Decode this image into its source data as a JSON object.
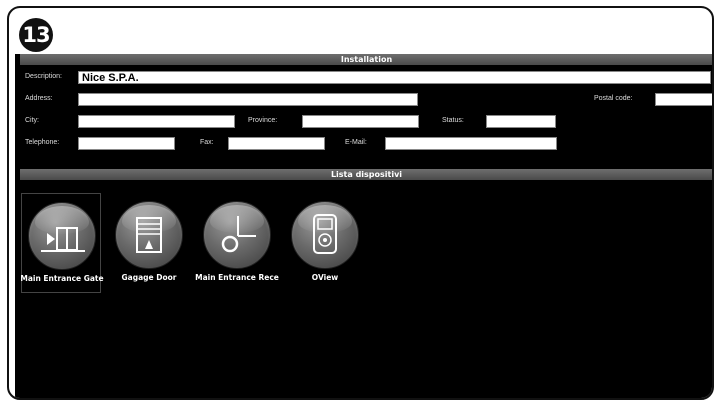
{
  "step": {
    "number": "13"
  },
  "installation": {
    "title": "Installation",
    "description": {
      "label": "Description:",
      "value": "Nice S.P.A."
    },
    "address": {
      "label": "Address:",
      "value": ""
    },
    "postal_code": {
      "label": "Postal code:",
      "value": ""
    },
    "city": {
      "label": "City:",
      "value": ""
    },
    "province": {
      "label": "Province:",
      "value": ""
    },
    "status": {
      "label": "Status:",
      "value": ""
    },
    "telephone": {
      "label": "Telephone:",
      "value": ""
    },
    "fax": {
      "label": "Fax:",
      "value": ""
    },
    "email": {
      "label": "E-Mail:",
      "value": ""
    }
  },
  "devices": {
    "title": "Lista dispositivi",
    "items": [
      {
        "label": "Main Entrance Gate",
        "icon": "gate-icon"
      },
      {
        "label": "Gagage Door",
        "icon": "garage-door-icon"
      },
      {
        "label": "Main Entrance Rece",
        "icon": "receiver-icon"
      },
      {
        "label": "OView",
        "icon": "oview-remote-icon"
      }
    ]
  },
  "colors": {
    "background": "#000000",
    "section_bar": "#5a5a5a",
    "field": "#ffffff"
  }
}
